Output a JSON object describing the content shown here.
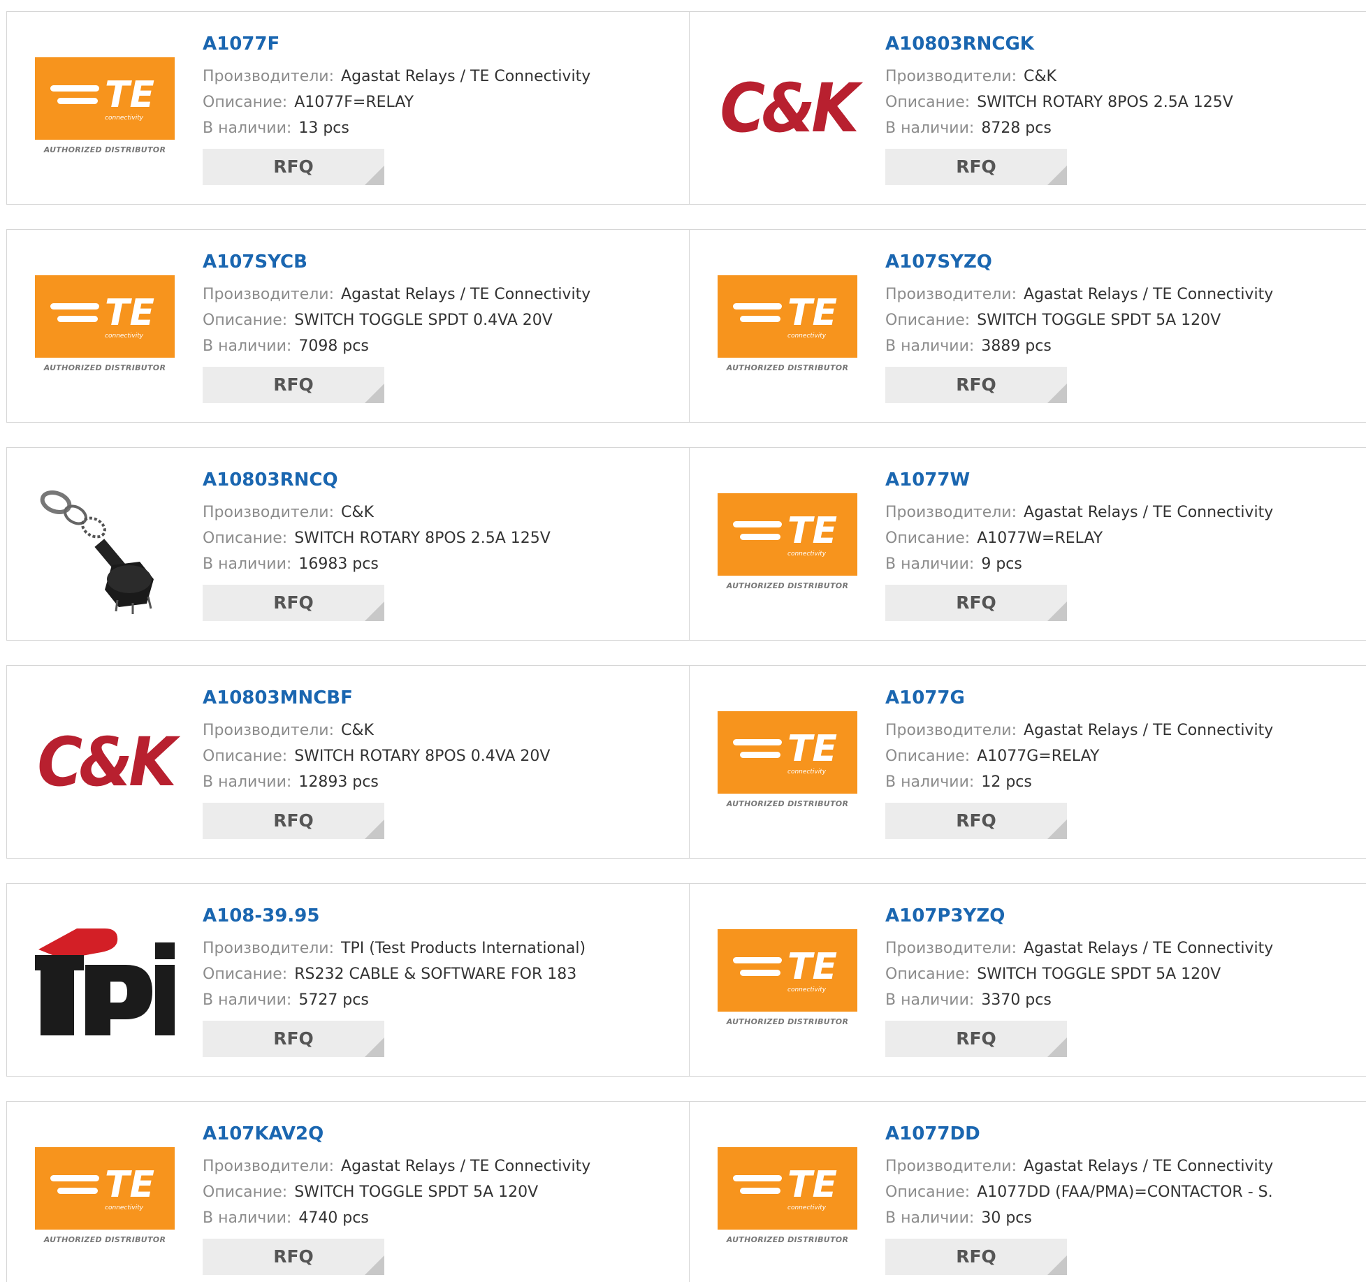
{
  "labels": {
    "manufacturer": "Производители:",
    "description": "Описание:",
    "stock": "В наличии:",
    "rfq": "RFQ"
  },
  "logos": {
    "te": {
      "main": "TE",
      "sub": "connectivity",
      "badge": "AUTHORIZED DISTRIBUTOR"
    },
    "ck": {
      "text": "C&K"
    },
    "tpi": {
      "text": "tpi"
    }
  },
  "colors": {
    "part_link": "#1a66b0",
    "te_orange": "#f7941d",
    "ck_red": "#b8202f",
    "rfq_bg": "#ececec"
  },
  "products": [
    {
      "part": "A1077F",
      "manufacturer": "Agastat Relays / TE Connectivity",
      "description": "A1077F=RELAY",
      "stock": "13 pcs",
      "logo": "te"
    },
    {
      "part": "A10803RNCGK",
      "manufacturer": "C&K",
      "description": "SWITCH ROTARY 8POS 2.5A 125V",
      "stock": "8728 pcs",
      "logo": "ck"
    },
    {
      "part": "A107SYCB",
      "manufacturer": "Agastat Relays / TE Connectivity",
      "description": "SWITCH TOGGLE SPDT 0.4VA 20V",
      "stock": "7098 pcs",
      "logo": "te"
    },
    {
      "part": "A107SYZQ",
      "manufacturer": "Agastat Relays / TE Connectivity",
      "description": "SWITCH TOGGLE SPDT 5A 120V",
      "stock": "3889 pcs",
      "logo": "te"
    },
    {
      "part": "A10803RNCQ",
      "manufacturer": "C&K",
      "description": "SWITCH ROTARY 8POS 2.5A 125V",
      "stock": "16983 pcs",
      "logo": "rotary-switch-photo"
    },
    {
      "part": "A1077W",
      "manufacturer": "Agastat Relays / TE Connectivity",
      "description": "A1077W=RELAY",
      "stock": "9 pcs",
      "logo": "te"
    },
    {
      "part": "A10803MNCBF",
      "manufacturer": "C&K",
      "description": "SWITCH ROTARY 8POS 0.4VA 20V",
      "stock": "12893 pcs",
      "logo": "ck"
    },
    {
      "part": "A1077G",
      "manufacturer": "Agastat Relays / TE Connectivity",
      "description": "A1077G=RELAY",
      "stock": "12 pcs",
      "logo": "te"
    },
    {
      "part": "A108-39.95",
      "manufacturer": "TPI (Test Products International)",
      "description": "RS232 CABLE & SOFTWARE FOR 183",
      "stock": "5727 pcs",
      "logo": "tpi"
    },
    {
      "part": "A107P3YZQ",
      "manufacturer": "Agastat Relays / TE Connectivity",
      "description": "SWITCH TOGGLE SPDT 5A 120V",
      "stock": "3370 pcs",
      "logo": "te"
    },
    {
      "part": "A107KAV2Q",
      "manufacturer": "Agastat Relays / TE Connectivity",
      "description": "SWITCH TOGGLE SPDT 5A 120V",
      "stock": "4740 pcs",
      "logo": "te"
    },
    {
      "part": "A1077DD",
      "manufacturer": "Agastat Relays / TE Connectivity",
      "description": "A1077DD (FAA/PMA)=CONTACTOR - S.",
      "stock": "30 pcs",
      "logo": "te"
    }
  ]
}
